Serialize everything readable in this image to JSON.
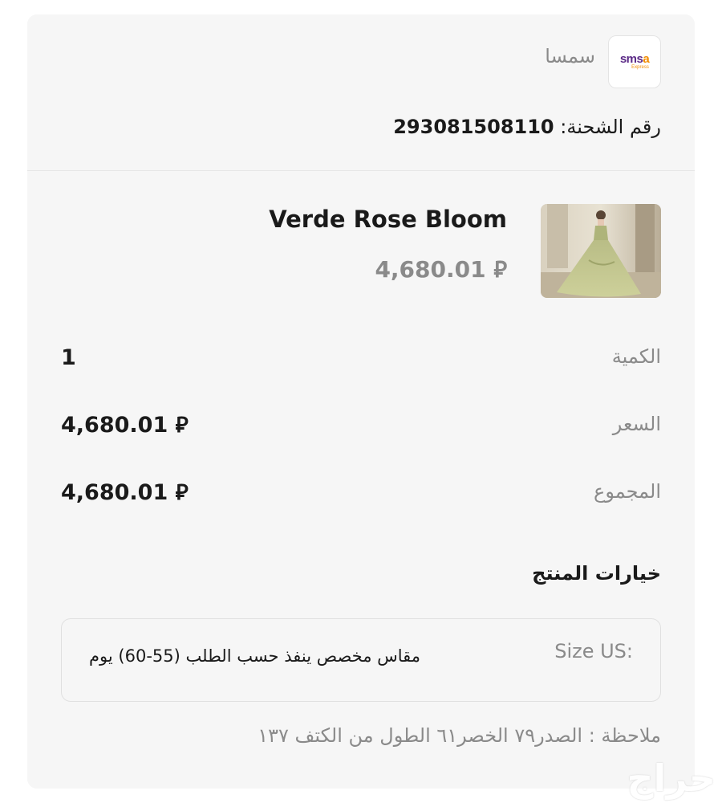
{
  "shipping": {
    "courier_name": "سمسا",
    "logo_word_a": "sms",
    "logo_word_b": "a",
    "logo_sub": "Express",
    "shipment_label": "رقم الشحنة:",
    "shipment_number": "293081508110"
  },
  "product": {
    "name": "Verde Rose Bloom",
    "price": "4,680.01 ⃁",
    "image_icon": "dress-photo"
  },
  "summary": {
    "quantity_label": "الكمية",
    "quantity_value": "1",
    "price_label": "السعر",
    "price_value": "4,680.01 ⃁",
    "total_label": "المجموع",
    "total_value": "4,680.01 ⃁"
  },
  "options": {
    "title": "خيارات المنتج",
    "items": [
      {
        "key": "Size US:",
        "value": "مقاس مخصص ينفذ حسب الطلب (55-60) يوم"
      }
    ],
    "note": "ملاحظة : الصدر٧٩ الخصر٦١ الطول من الكتف ١٣٧"
  },
  "watermark": "حراج",
  "colors": {
    "card_bg": "#f6f6f6",
    "muted_text": "#8a8a8a",
    "primary_text": "#1a1a1a",
    "logo_purple": "#5b2a86",
    "logo_orange": "#f28c00"
  }
}
